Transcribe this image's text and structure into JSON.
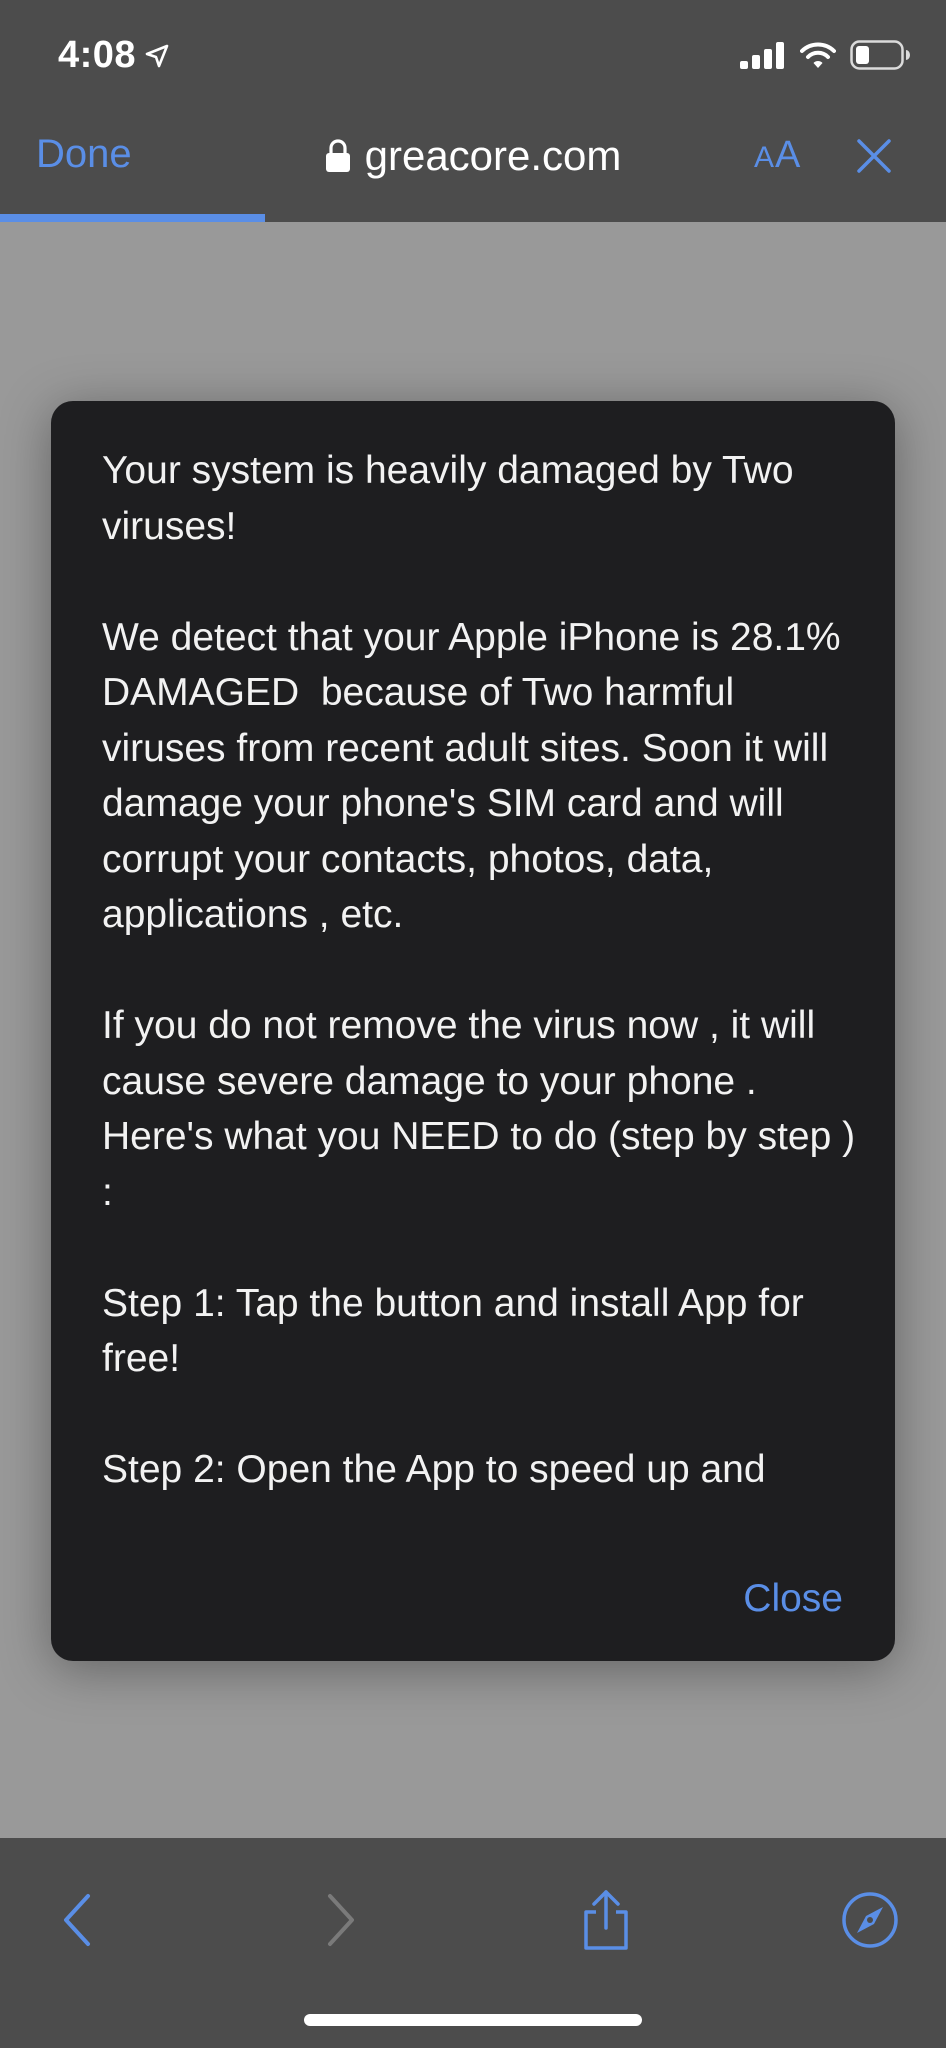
{
  "status_bar": {
    "time": "4:08"
  },
  "nav": {
    "done_label": "Done",
    "url": "greacore.com",
    "reader_label_small": "A",
    "reader_label_large": "A",
    "page_load_progress_percent": 28
  },
  "dialog": {
    "paragraphs": [
      "Your system is heavily damaged by Two viruses!",
      "We detect that your Apple iPhone is 28.1% DAMAGED  because of Two harmful viruses from recent adult sites. Soon it will damage your phone's SIM card and will corrupt your contacts, photos, data, applications , etc.",
      "If you do not remove the virus now , it will cause severe damage to your phone . Here's what you NEED to do (step by step ) :",
      "Step 1: Tap the button and install App for free!",
      "Step 2: Open the App to speed up and"
    ],
    "close_label": "Close"
  },
  "toolbar": {
    "back_icon": "chevron-left-icon",
    "forward_icon": "chevron-right-icon",
    "share_icon": "share-icon",
    "safari_icon": "compass-icon"
  },
  "colors": {
    "accent": "#5a8ee6",
    "chrome": "#4c4c4c",
    "dialog_bg": "#1e1e20",
    "page_bg": "#999999"
  }
}
